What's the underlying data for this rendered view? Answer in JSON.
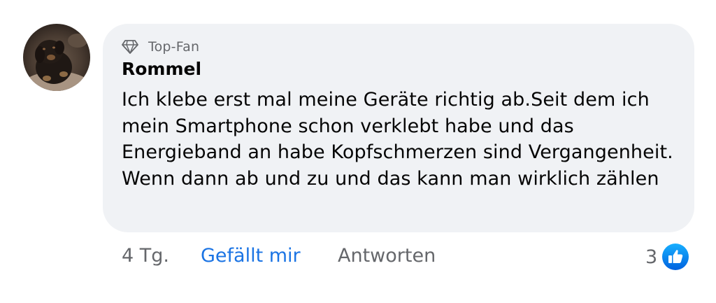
{
  "comment": {
    "badge": {
      "icon": "diamond-icon",
      "label": "Top-Fan"
    },
    "author": "Rommel",
    "text": "Ich klebe erst mal meine Geräte richtig ab.Seit dem ich mein Smartphone schon verklebt habe und das Energieband an habe Kopfschmerzen sind Vergangenheit. Wenn dann ab und zu und das kann man wirklich zählen",
    "avatar_icon": "user-avatar",
    "bubble_color": "#f0f2f5"
  },
  "actions": {
    "time": "4 Tg.",
    "like_label": "Gefällt mir",
    "reply_label": "Antworten",
    "reaction_count": "3",
    "reaction_icon": "thumbs-up-icon",
    "like_color": "#1b74e4",
    "muted_color": "#65676b"
  }
}
